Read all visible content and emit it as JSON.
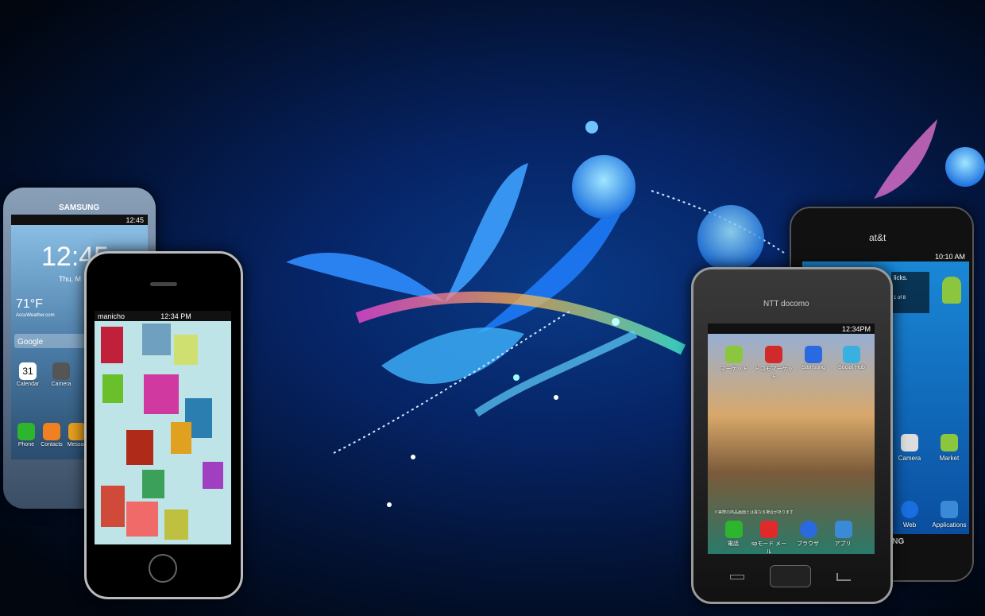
{
  "colors": {
    "accent": "#4aa8ff",
    "glow": "#7fd8ff"
  },
  "samsung": {
    "brand": "SAMSUNG",
    "status_time": "12:45",
    "clock": "12:45",
    "date": "Thu, M",
    "temp": "71°F",
    "weather_src": "AccuWeather.com",
    "search": "Google",
    "cal_day": "31",
    "calendar": "Calendar",
    "camera": "Camera",
    "phone": "Phone",
    "contacts": "Contacts",
    "messages": "Messag"
  },
  "iphone": {
    "carrier": "manicho",
    "time": "12:34 PM"
  },
  "docomo": {
    "brand": "NTT docomo",
    "time": "12:34PM",
    "app1": "マーケット",
    "app2": "ドコモマーケット",
    "app3": "Samsung",
    "app4": "Social Hub",
    "dock1": "電話",
    "dock2": "spモード メール",
    "dock3": "ブラウザ",
    "dock4": "アプリ",
    "notice": "※実際の商品画面とは異なる場合があります"
  },
  "att": {
    "brand": "at&t",
    "time": "10:10 AM",
    "widget_text": "licks.",
    "widget_page": "1 of 8",
    "camera": "Camera",
    "market": "Market",
    "web": "Web",
    "applications": "Applications",
    "brand_bottom": "UNG"
  }
}
